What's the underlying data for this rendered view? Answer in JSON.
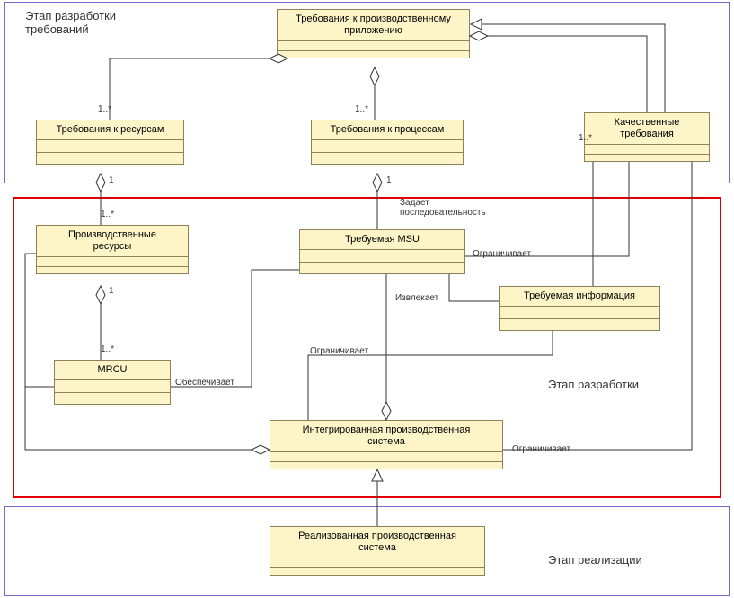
{
  "frames": {
    "req_stage": {
      "label": "Этап разработки\nтребований"
    },
    "dev_stage": {
      "label": "Этап разработки"
    },
    "impl_stage": {
      "label": "Этап реализации"
    }
  },
  "classes": {
    "app_req": {
      "title": "Требования к производственному\nприложению"
    },
    "res_req": {
      "title": "Требования к ресурсам"
    },
    "proc_req": {
      "title": "Требования к процессам"
    },
    "qual_req": {
      "title": "Качественные\nтребования"
    },
    "prod_res": {
      "title": "Производственные\nресурсы"
    },
    "req_msu": {
      "title": "Требуемая MSU"
    },
    "req_info": {
      "title": "Требуемая информация"
    },
    "mrcu": {
      "title": "MRCU"
    },
    "int_sys": {
      "title": "Интегрированная производственная\nсистема"
    },
    "impl_sys": {
      "title": "Реализованная производственная\nсистема"
    }
  },
  "mults": {
    "m1": "1",
    "m1s": "1..*"
  },
  "labels": {
    "sequence": "Задает\nпоследовательность",
    "restricts": "Ограничивает",
    "extracts": "Извлекает",
    "provides": "Обеспечивает"
  },
  "chart_data": {
    "type": "uml-class-diagram",
    "classes": [
      "Требования к производственному приложению",
      "Требования к ресурсам",
      "Требования к процессам",
      "Качественные требования",
      "Производственные ресурсы",
      "Требуемая MSU",
      "Требуемая информация",
      "MRCU",
      "Интегрированная производственная система",
      "Реализованная производственная система"
    ],
    "relationships": [
      {
        "from": "Требования к производственному приложению",
        "to": "Требования к ресурсам",
        "type": "aggregation",
        "mult_from": "",
        "mult_to": "1..*"
      },
      {
        "from": "Требования к производственному приложению",
        "to": "Требования к процессам",
        "type": "aggregation",
        "mult_from": "",
        "mult_to": "1..*"
      },
      {
        "from": "Требования к производственному приложению",
        "to": "Качественные требования",
        "type": "aggregation",
        "mult_from": "",
        "mult_to": "1..*"
      },
      {
        "from": "Требования к ресурсам",
        "to": "Производственные ресурсы",
        "type": "aggregation",
        "mult_from": "1",
        "mult_to": "1..*"
      },
      {
        "from": "Требования к процессам",
        "to": "Требуемая MSU",
        "type": "aggregation",
        "mult_from": "1",
        "mult_to": "",
        "label": "Задает последовательность"
      },
      {
        "from": "Производственные ресурсы",
        "to": "MRCU",
        "type": "aggregation",
        "mult_from": "1",
        "mult_to": "1..*"
      },
      {
        "from": "MRCU",
        "to": "Требуемая MSU",
        "type": "association",
        "label": "Обеспечивает"
      },
      {
        "from": "Качественные требования",
        "to": "Требуемая MSU",
        "type": "association",
        "label": "Ограничивает"
      },
      {
        "from": "Требуемая информация",
        "to": "Требуемая MSU",
        "type": "association",
        "label": "Извлекает"
      },
      {
        "from": "Требуемая информация",
        "to": "Интегрированная производственная система",
        "type": "association",
        "label": "Ограничивает"
      },
      {
        "from": "Интегрированная производственная система",
        "to": "Требуемая MSU",
        "type": "aggregation"
      },
      {
        "from": "Интегрированная производственная система",
        "to": "MRCU",
        "type": "aggregation"
      },
      {
        "from": "Качественные требования",
        "to": "Интегрированная производственная система",
        "type": "association",
        "label": "Ограничивает"
      },
      {
        "from": "Реализованная производственная система",
        "to": "Интегрированная производственная система",
        "type": "generalization"
      },
      {
        "from": "Качественные требования",
        "to": "Требования к производственному приложению",
        "type": "generalization"
      }
    ],
    "packages": [
      {
        "name": "Этап разработки требований",
        "contains": [
          "Требования к производственному приложению",
          "Требования к ресурсам",
          "Требования к процессам",
          "Качественные требования"
        ]
      },
      {
        "name": "Этап разработки",
        "contains": [
          "Производственные ресурсы",
          "Требуемая MSU",
          "Требуемая информация",
          "MRCU",
          "Интегрированная производственная система"
        ]
      },
      {
        "name": "Этап реализации",
        "contains": [
          "Реализованная производственная система"
        ]
      }
    ]
  }
}
